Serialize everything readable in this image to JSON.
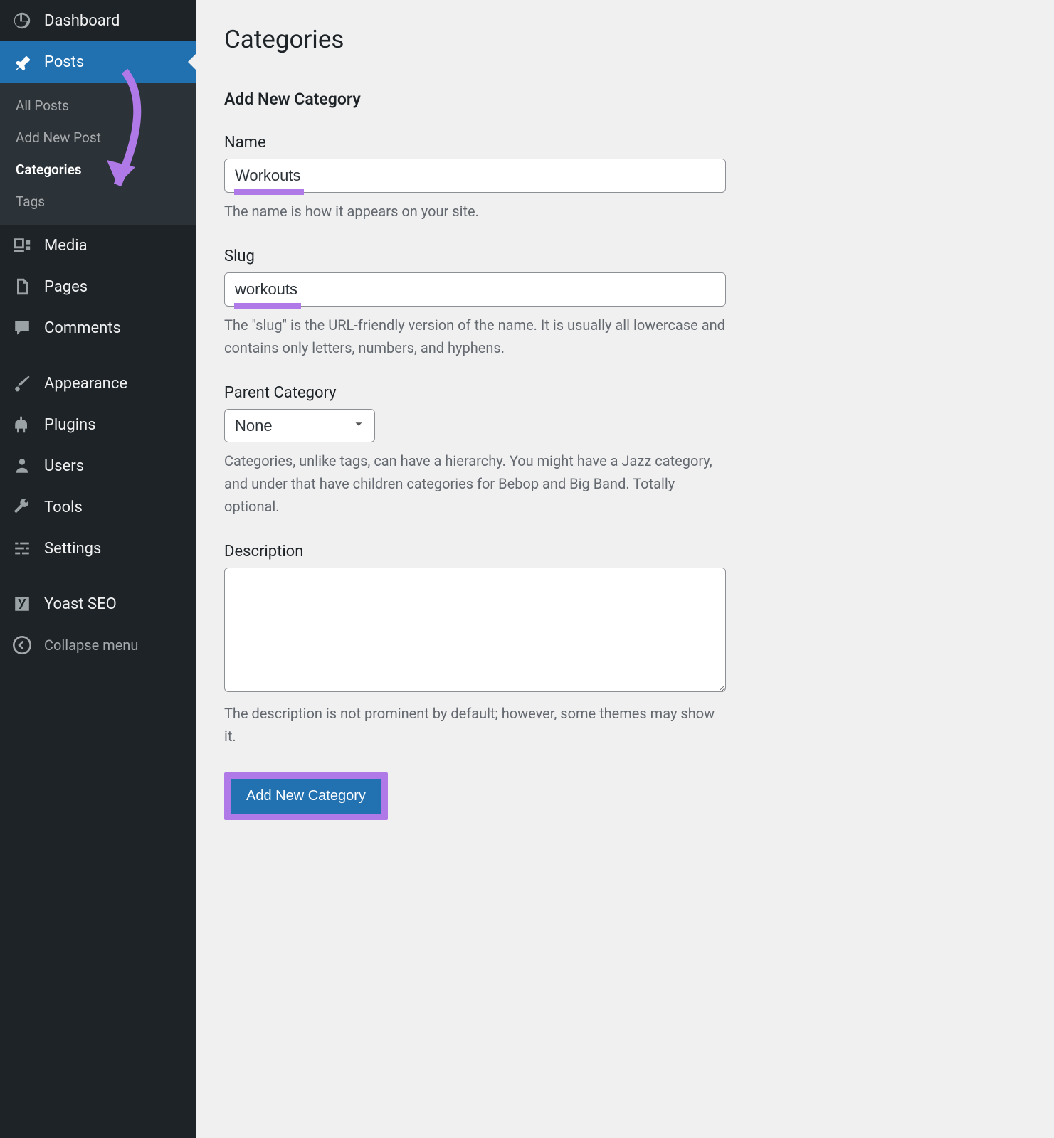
{
  "sidebar": {
    "dashboard": "Dashboard",
    "posts": {
      "label": "Posts",
      "submenu": {
        "all": "All Posts",
        "add": "Add New Post",
        "categories": "Categories",
        "tags": "Tags"
      }
    },
    "media": "Media",
    "pages": "Pages",
    "comments": "Comments",
    "appearance": "Appearance",
    "plugins": "Plugins",
    "users": "Users",
    "tools": "Tools",
    "settings": "Settings",
    "yoast": "Yoast SEO",
    "collapse": "Collapse menu"
  },
  "main": {
    "page_title": "Categories",
    "form_title": "Add New Category",
    "name": {
      "label": "Name",
      "value": "Workouts",
      "help": "The name is how it appears on your site."
    },
    "slug": {
      "label": "Slug",
      "value": "workouts",
      "help": "The \"slug\" is the URL-friendly version of the name. It is usually all lowercase and contains only letters, numbers, and hyphens."
    },
    "parent": {
      "label": "Parent Category",
      "value": "None",
      "help": "Categories, unlike tags, can have a hierarchy. You might have a Jazz category, and under that have children categories for Bebop and Big Band. Totally optional."
    },
    "description": {
      "label": "Description",
      "value": "",
      "help": "The description is not prominent by default; however, some themes may show it."
    },
    "submit": "Add New Category"
  }
}
